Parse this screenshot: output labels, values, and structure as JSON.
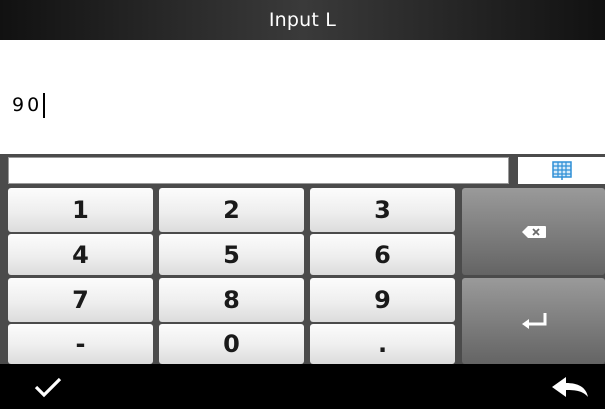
{
  "title": "Input L",
  "input": {
    "value": "90"
  },
  "keypad": {
    "keys": [
      "1",
      "2",
      "3",
      "4",
      "5",
      "6",
      "7",
      "8",
      "9",
      "-",
      "0",
      "."
    ],
    "backspace_icon": "backspace-icon",
    "enter_icon": "enter-icon"
  },
  "toggle_icon": "grid-keyboard-icon",
  "footer": {
    "confirm_icon": "checkmark-icon",
    "back_icon": "back-arrow-icon"
  },
  "colors": {
    "title_bar": "#2a2a2a",
    "key_light": "#eeeeee",
    "key_dark": "#7c7c7c",
    "toggle_icon": "#2f8fd6",
    "footer": "#000000"
  }
}
